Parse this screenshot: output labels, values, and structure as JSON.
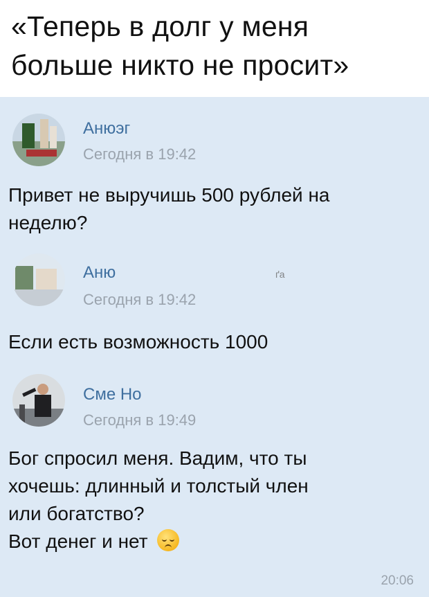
{
  "caption": {
    "line1": "«Теперь в долг у меня",
    "line2": "больше никто не просит»"
  },
  "messages": [
    {
      "sender": "Анюэг",
      "time": "Сегодня в 19:42",
      "text_lines": [
        "Привет не выручишь 500 рублей на",
        "неделю?"
      ],
      "avatar_icon": "avatar-photo-monument"
    },
    {
      "sender": "Аню",
      "time": "Сегодня в 19:42",
      "text_lines": [
        "Если есть возможность 1000"
      ],
      "avatar_icon": "avatar-photo-monument",
      "glitch_right": "ґа"
    },
    {
      "sender": "Сме Но",
      "time": "Сегодня в 19:49",
      "text_lines": [
        "Бог спросил меня. Вадим, что ты",
        "хочешь: длинный и толстый член",
        "или богатство?",
        "Вот денег и нет"
      ],
      "avatar_icon": "avatar-photo-man",
      "end_emoji": "pensive-face-icon"
    }
  ],
  "footer_time": "20:06",
  "colors": {
    "chat_bg": "#dde9f5",
    "sender": "#3f6f9f",
    "time": "#9aa3ad"
  }
}
